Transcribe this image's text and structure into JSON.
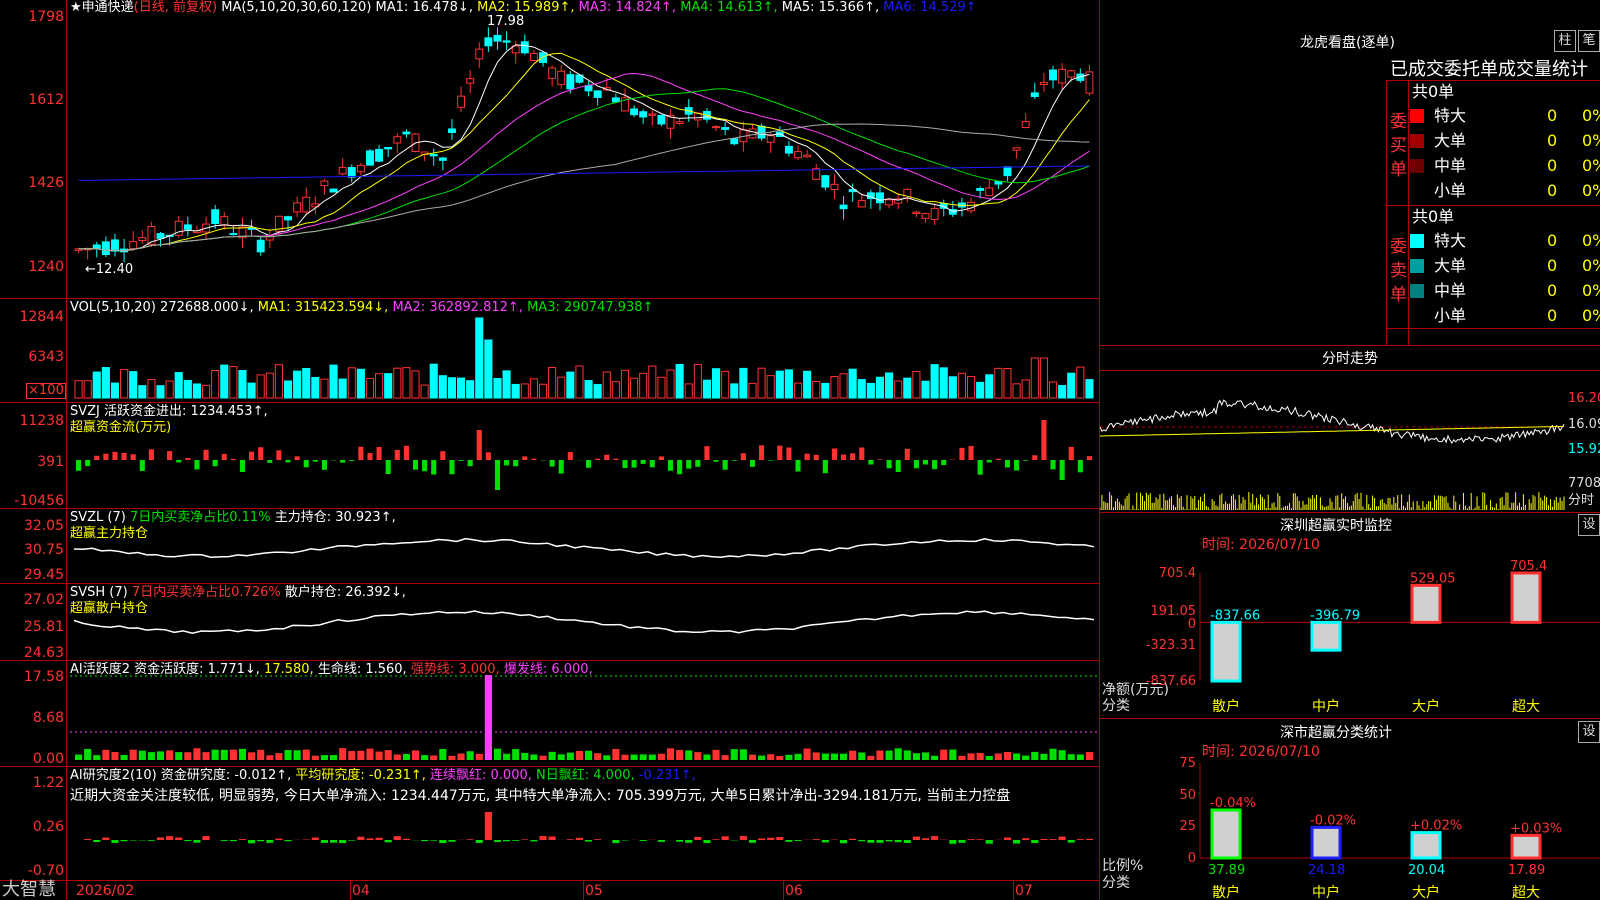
{
  "app": {
    "brand": "大智慧"
  },
  "stock_header": {
    "star": "★",
    "name": "申通快递",
    "period": "(日线, 前复权)",
    "ma_cfg": "MA(5,10,20,30,60,120)",
    "ma1": "MA1: 16.478↓,",
    "ma2": "MA2: 15.989↑,",
    "ma3": "MA3: 14.824↑,",
    "ma4": "MA4: 14.613↑,",
    "ma5": "MA5: 15.366↑,",
    "ma6": "MA6: 14.529↑"
  },
  "price_axis": [
    "1798",
    "1612",
    "1426",
    "1240"
  ],
  "high_annot": "17.98",
  "low_annot": "←12.40",
  "vol_header": {
    "cfg": "VOL(5,10,20)",
    "cur": "272688.000↓,",
    "ma1": "MA1: 315423.594↓,",
    "ma2": "MA2: 362892.812↑,",
    "ma3": "MA3: 290747.938↑"
  },
  "vol_axis": [
    "12844",
    "6343",
    "×100"
  ],
  "svzj_header": {
    "name": "SVZJ",
    "text": "活跃资金进出: 1234.453↑,",
    "sub": "超赢资金流(万元)"
  },
  "svzj_axis": [
    "11238",
    "391",
    "-10456"
  ],
  "svzl_header": {
    "name": "SVZL  (7)",
    "ratio": "7日内买卖净占比0.11%",
    "text": "主力持仓: 30.923↑,",
    "sub": "超赢主力持仓"
  },
  "svzl_axis": [
    "32.05",
    "30.75",
    "29.45"
  ],
  "svsh_header": {
    "name": "SVSH  (7)",
    "ratio": "7日内买卖净占比0.726%",
    "text": "散户持仓: 26.392↓,",
    "sub": "超赢散户持仓"
  },
  "svsh_axis": [
    "27.02",
    "25.81",
    "24.63"
  ],
  "ai1_header": {
    "name": "AI活跃度2",
    "a": "资金活跃度: 1.771↓,",
    "b": "17.580,",
    "c": "生命线: 1.560,",
    "d": "强势线: 3.000,",
    "e": "爆发线: 6.000,"
  },
  "ai1_axis": [
    "17.58",
    "8.68",
    "0.00"
  ],
  "ai2_header": {
    "name": "AI研究度2(10)",
    "a": "资金研究度: -0.012↑,",
    "b": "平均研究度: -0.231↑,",
    "c": "连续飘红: 0.000,",
    "d": "N日飘红: 4.000,",
    "e": "-0.231↑,"
  },
  "ai2_comment": "近期大资金关注度较低, 明显弱势, 今日大单净流入: 1234.447万元, 其中特大单净流入: 705.399万元, 大单5日累计净出-3294.181万元, 当前主力控盘",
  "ai2_axis": [
    "1.22",
    "0.26",
    "-0.70"
  ],
  "date_axis": [
    "2026/02",
    "04",
    "05",
    "06",
    "07"
  ],
  "dragon": {
    "title": "龙虎看盘(逐单)",
    "btn_bar": "柱",
    "btn_line": "笔",
    "subtitle": "已成交委托单成交量统计",
    "buy_label": "委买单",
    "sell_label": "委卖单",
    "buy_total": "共0单",
    "sell_total": "共0单",
    "buy_rows": [
      {
        "label": "特大",
        "count": "0",
        "pct": "0%",
        "color": "#ff0000"
      },
      {
        "label": "大单",
        "count": "0",
        "pct": "0%",
        "color": "#a00000"
      },
      {
        "label": "中单",
        "count": "0",
        "pct": "0%",
        "color": "#700000"
      },
      {
        "label": "小单",
        "count": "0",
        "pct": "0%",
        "color": "#000000"
      }
    ],
    "sell_rows": [
      {
        "label": "特大",
        "count": "0",
        "pct": "0%",
        "color": "#00ffff"
      },
      {
        "label": "大单",
        "count": "0",
        "pct": "0%",
        "color": "#00a0a0"
      },
      {
        "label": "中单",
        "count": "0",
        "pct": "0%",
        "color": "#008080"
      },
      {
        "label": "小单",
        "count": "0",
        "pct": "0%",
        "color": "#000000"
      }
    ]
  },
  "intraday": {
    "title": "分时走势",
    "axis": [
      "16.20",
      "16.09",
      "15.92"
    ],
    "vol_max": "7708",
    "vol_unit": "分时"
  },
  "sz_monitor": {
    "title": "深圳超赢实时监控",
    "settings": "设",
    "time": "时间: 2026/07/10",
    "axis": [
      "705.4",
      "191.05",
      "0",
      "-323.31",
      "-837.66"
    ],
    "y_label": "净额(万元)",
    "x_label": "分类",
    "cats": [
      "散户",
      "中户",
      "大户",
      "超大"
    ]
  },
  "sz_classify": {
    "title": "深市超赢分类统计",
    "settings": "设",
    "time": "时间: 2026/07/10",
    "axis": [
      "75",
      "50",
      "25",
      "0"
    ],
    "y_label": "比例%",
    "x_label": "分类",
    "cats": [
      "散户",
      "中户",
      "大户",
      "超大"
    ]
  },
  "chart_data": [
    {
      "type": "bar",
      "title": "深圳超赢实时监控",
      "categories": [
        "散户",
        "中户",
        "大户",
        "超大"
      ],
      "values": [
        -837.66,
        -396.79,
        529.05,
        705.4
      ],
      "ylim": [
        -837.66,
        705.4
      ],
      "colors": [
        "#00ffff",
        "#00ffff",
        "#ff3030",
        "#ff3030"
      ]
    },
    {
      "type": "bar",
      "title": "深市超赢分类统计",
      "categories": [
        "散户",
        "中户",
        "大户",
        "超大"
      ],
      "values": [
        37.89,
        24.18,
        20.04,
        17.89
      ],
      "changes": [
        "-0.04%",
        "-0.02%",
        "+0.02%",
        "+0.03%"
      ],
      "ylim": [
        0,
        75
      ],
      "colors": [
        "#00ff00",
        "#2020ff",
        "#00ffff",
        "#ff3030"
      ]
    }
  ]
}
